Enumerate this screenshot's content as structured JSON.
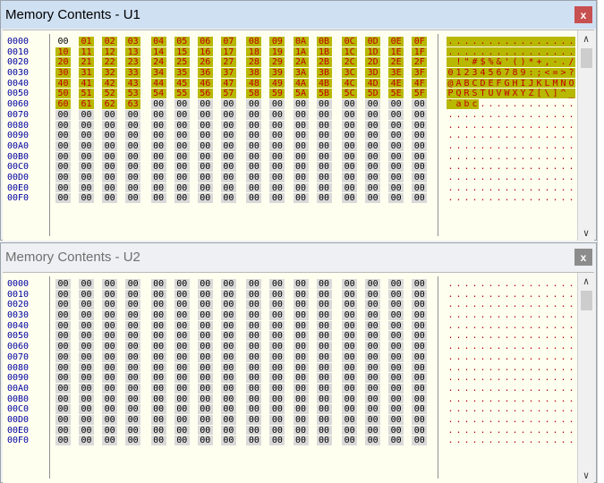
{
  "windows": [
    {
      "id": "win1",
      "title": "Memory Contents - U1",
      "close_label": "x",
      "active": true,
      "addresses": [
        "0000",
        "0010",
        "0020",
        "0030",
        "0040",
        "0050",
        "0060",
        "0070",
        "0080",
        "0090",
        "00A0",
        "00B0",
        "00C0",
        "00D0",
        "00E0",
        "00F0"
      ],
      "rows": [
        [
          "00",
          "01",
          "02",
          "03",
          "04",
          "05",
          "06",
          "07",
          "08",
          "09",
          "0A",
          "0B",
          "0C",
          "0D",
          "0E",
          "0F"
        ],
        [
          "10",
          "11",
          "12",
          "13",
          "14",
          "15",
          "16",
          "17",
          "18",
          "19",
          "1A",
          "1B",
          "1C",
          "1D",
          "1E",
          "1F"
        ],
        [
          "20",
          "21",
          "22",
          "23",
          "24",
          "25",
          "26",
          "27",
          "28",
          "29",
          "2A",
          "2B",
          "2C",
          "2D",
          "2E",
          "2F"
        ],
        [
          "30",
          "31",
          "32",
          "33",
          "34",
          "35",
          "36",
          "37",
          "38",
          "39",
          "3A",
          "3B",
          "3C",
          "3D",
          "3E",
          "3F"
        ],
        [
          "40",
          "41",
          "42",
          "43",
          "44",
          "45",
          "46",
          "47",
          "48",
          "49",
          "4A",
          "4B",
          "4C",
          "4D",
          "4E",
          "4F"
        ],
        [
          "50",
          "51",
          "52",
          "53",
          "54",
          "55",
          "56",
          "57",
          "58",
          "59",
          "5A",
          "5B",
          "5C",
          "5D",
          "5E",
          "5F"
        ],
        [
          "60",
          "61",
          "62",
          "63",
          "00",
          "00",
          "00",
          "00",
          "00",
          "00",
          "00",
          "00",
          "00",
          "00",
          "00",
          "00"
        ],
        [
          "00",
          "00",
          "00",
          "00",
          "00",
          "00",
          "00",
          "00",
          "00",
          "00",
          "00",
          "00",
          "00",
          "00",
          "00",
          "00"
        ],
        [
          "00",
          "00",
          "00",
          "00",
          "00",
          "00",
          "00",
          "00",
          "00",
          "00",
          "00",
          "00",
          "00",
          "00",
          "00",
          "00"
        ],
        [
          "00",
          "00",
          "00",
          "00",
          "00",
          "00",
          "00",
          "00",
          "00",
          "00",
          "00",
          "00",
          "00",
          "00",
          "00",
          "00"
        ],
        [
          "00",
          "00",
          "00",
          "00",
          "00",
          "00",
          "00",
          "00",
          "00",
          "00",
          "00",
          "00",
          "00",
          "00",
          "00",
          "00"
        ],
        [
          "00",
          "00",
          "00",
          "00",
          "00",
          "00",
          "00",
          "00",
          "00",
          "00",
          "00",
          "00",
          "00",
          "00",
          "00",
          "00"
        ],
        [
          "00",
          "00",
          "00",
          "00",
          "00",
          "00",
          "00",
          "00",
          "00",
          "00",
          "00",
          "00",
          "00",
          "00",
          "00",
          "00"
        ],
        [
          "00",
          "00",
          "00",
          "00",
          "00",
          "00",
          "00",
          "00",
          "00",
          "00",
          "00",
          "00",
          "00",
          "00",
          "00",
          "00"
        ],
        [
          "00",
          "00",
          "00",
          "00",
          "00",
          "00",
          "00",
          "00",
          "00",
          "00",
          "00",
          "00",
          "00",
          "00",
          "00",
          "00"
        ],
        [
          "00",
          "00",
          "00",
          "00",
          "00",
          "00",
          "00",
          "00",
          "00",
          "00",
          "00",
          "00",
          "00",
          "00",
          "00",
          "00"
        ]
      ],
      "ascii": [
        "................",
        "................",
        " !\"#$%&'()*+,-./",
        "0123456789:;<=>?",
        "@ABCDEFGHIJKLMNO",
        "PQRSTUVWXYZ[\\]^_",
        "`abc............",
        "................",
        "................",
        "................",
        "................",
        "................",
        "................",
        "................",
        "................",
        "................"
      ],
      "highlighted_byte_count": 100
    },
    {
      "id": "win2",
      "title": "Memory Contents - U2",
      "close_label": "x",
      "active": false,
      "addresses": [
        "0000",
        "0010",
        "0020",
        "0030",
        "0040",
        "0050",
        "0060",
        "0070",
        "0080",
        "0090",
        "00A0",
        "00B0",
        "00C0",
        "00D0",
        "00E0",
        "00F0"
      ],
      "rows": [
        [
          "00",
          "00",
          "00",
          "00",
          "00",
          "00",
          "00",
          "00",
          "00",
          "00",
          "00",
          "00",
          "00",
          "00",
          "00",
          "00"
        ],
        [
          "00",
          "00",
          "00",
          "00",
          "00",
          "00",
          "00",
          "00",
          "00",
          "00",
          "00",
          "00",
          "00",
          "00",
          "00",
          "00"
        ],
        [
          "00",
          "00",
          "00",
          "00",
          "00",
          "00",
          "00",
          "00",
          "00",
          "00",
          "00",
          "00",
          "00",
          "00",
          "00",
          "00"
        ],
        [
          "00",
          "00",
          "00",
          "00",
          "00",
          "00",
          "00",
          "00",
          "00",
          "00",
          "00",
          "00",
          "00",
          "00",
          "00",
          "00"
        ],
        [
          "00",
          "00",
          "00",
          "00",
          "00",
          "00",
          "00",
          "00",
          "00",
          "00",
          "00",
          "00",
          "00",
          "00",
          "00",
          "00"
        ],
        [
          "00",
          "00",
          "00",
          "00",
          "00",
          "00",
          "00",
          "00",
          "00",
          "00",
          "00",
          "00",
          "00",
          "00",
          "00",
          "00"
        ],
        [
          "00",
          "00",
          "00",
          "00",
          "00",
          "00",
          "00",
          "00",
          "00",
          "00",
          "00",
          "00",
          "00",
          "00",
          "00",
          "00"
        ],
        [
          "00",
          "00",
          "00",
          "00",
          "00",
          "00",
          "00",
          "00",
          "00",
          "00",
          "00",
          "00",
          "00",
          "00",
          "00",
          "00"
        ],
        [
          "00",
          "00",
          "00",
          "00",
          "00",
          "00",
          "00",
          "00",
          "00",
          "00",
          "00",
          "00",
          "00",
          "00",
          "00",
          "00"
        ],
        [
          "00",
          "00",
          "00",
          "00",
          "00",
          "00",
          "00",
          "00",
          "00",
          "00",
          "00",
          "00",
          "00",
          "00",
          "00",
          "00"
        ],
        [
          "00",
          "00",
          "00",
          "00",
          "00",
          "00",
          "00",
          "00",
          "00",
          "00",
          "00",
          "00",
          "00",
          "00",
          "00",
          "00"
        ],
        [
          "00",
          "00",
          "00",
          "00",
          "00",
          "00",
          "00",
          "00",
          "00",
          "00",
          "00",
          "00",
          "00",
          "00",
          "00",
          "00"
        ],
        [
          "00",
          "00",
          "00",
          "00",
          "00",
          "00",
          "00",
          "00",
          "00",
          "00",
          "00",
          "00",
          "00",
          "00",
          "00",
          "00"
        ],
        [
          "00",
          "00",
          "00",
          "00",
          "00",
          "00",
          "00",
          "00",
          "00",
          "00",
          "00",
          "00",
          "00",
          "00",
          "00",
          "00"
        ],
        [
          "00",
          "00",
          "00",
          "00",
          "00",
          "00",
          "00",
          "00",
          "00",
          "00",
          "00",
          "00",
          "00",
          "00",
          "00",
          "00"
        ],
        [
          "00",
          "00",
          "00",
          "00",
          "00",
          "00",
          "00",
          "00",
          "00",
          "00",
          "00",
          "00",
          "00",
          "00",
          "00",
          "00"
        ]
      ],
      "ascii": [
        "................",
        "................",
        "................",
        "................",
        "................",
        "................",
        "................",
        "................",
        "................",
        "................",
        "................",
        "................",
        "................",
        "................",
        "................",
        "................"
      ],
      "highlighted_byte_count": 0
    }
  ],
  "scrollbar": {
    "up_icon": "scroll-up-arrow-icon",
    "down_icon": "scroll-down-arrow-icon"
  },
  "colors": {
    "highlight_bg": "#b8b800",
    "highlight_fg": "#c00000",
    "address_fg": "#0000a0",
    "client_bg": "#fffff0"
  }
}
